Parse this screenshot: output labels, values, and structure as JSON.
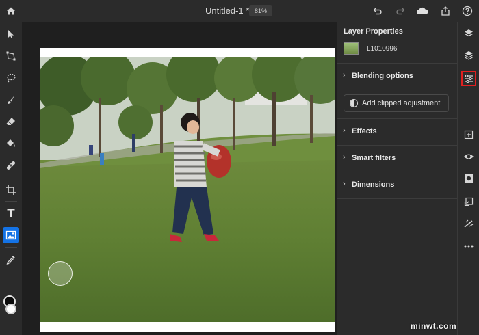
{
  "header": {
    "doc_title": "Untitled-1 *",
    "zoom": "81%"
  },
  "panel": {
    "title": "Layer Properties",
    "layer_name": "L1010996",
    "rows": [
      {
        "label": "Blending options"
      },
      {
        "label": "Effects"
      },
      {
        "label": "Smart filters"
      },
      {
        "label": "Dimensions"
      }
    ],
    "clip_button": "Add clipped adjustment"
  },
  "colors": {
    "accent": "#1473e6",
    "highlight": "#e02020",
    "foreground_color": "#0b0b0b",
    "background_color": "#ffffff"
  },
  "icons": {
    "toolbar": [
      "select-icon",
      "transform-icon",
      "lasso-icon",
      "brush-icon",
      "eraser-icon",
      "paint-bucket-icon",
      "healing-icon",
      "crop-icon",
      "type-icon",
      "place-image-icon",
      "eyedropper-icon"
    ],
    "rightbar": [
      "layers-icon",
      "layers-alt-icon",
      "adjustments-icon",
      "add-layer-icon",
      "visibility-icon",
      "mask-icon",
      "clip-icon",
      "magic-icon",
      "more-icon"
    ]
  },
  "watermark": "minwt.com"
}
